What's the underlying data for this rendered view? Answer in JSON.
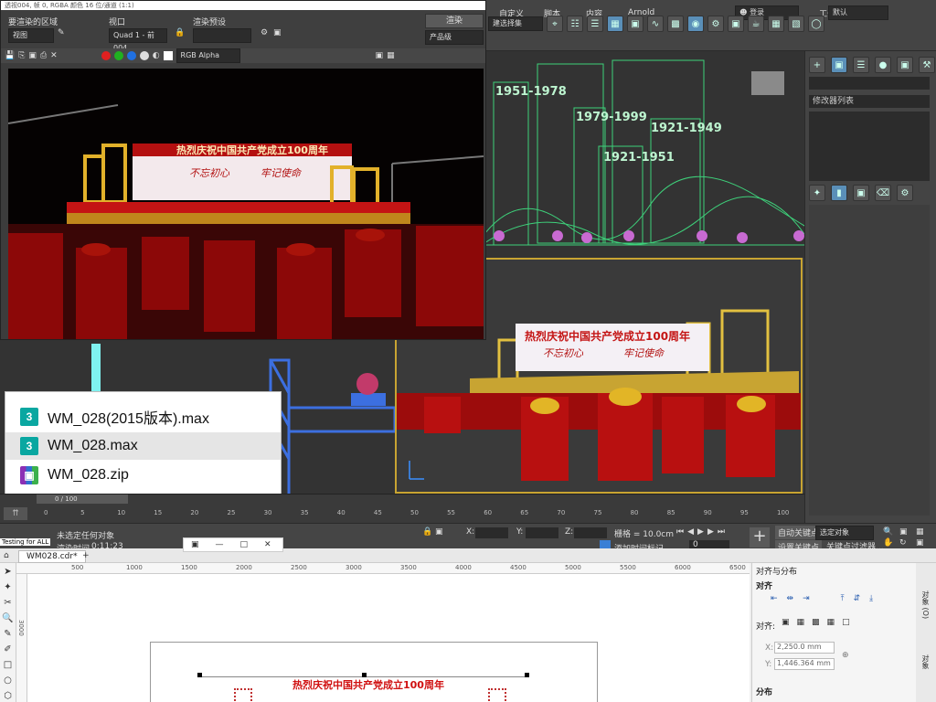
{
  "render_window": {
    "titlebar": "透视004, 帧 0, RGBA 颜色 16 位/通道 (1:1)",
    "area_label": "要渲染的区域",
    "area_value": "视图",
    "viewport_label": "视口",
    "viewport_value": "Quad 1 - 前004",
    "preset_label": "渲染预设",
    "preset_value": "",
    "render_button": "渲染",
    "product_value": "产品级",
    "channel_value": "RGB Alpha"
  },
  "main_toolbar": {
    "selection_set": "建选择集",
    "workspace_label": "工作区:",
    "workspace_value": "默认",
    "menu_items": [
      "自定义",
      "脚本",
      "内容",
      "Arnold"
    ],
    "login": "登录"
  },
  "render_scene": {
    "banner_title": "热烈庆祝中国共产党成立100周年",
    "slogan_left": "不忘初心",
    "slogan_right": "牢记使命"
  },
  "left_viewport": {
    "years": [
      "1951-1978",
      "1979-1999",
      "1921-1949",
      "1921-1951"
    ]
  },
  "files": [
    {
      "name": "WM_028(2015版本).max",
      "type": "max",
      "selected": false
    },
    {
      "name": "WM_028.max",
      "type": "max",
      "selected": true
    },
    {
      "name": "WM_028.zip",
      "type": "zip",
      "selected": false
    }
  ],
  "timeline": {
    "frame_counter": "0 / 100",
    "ticks": [
      "0",
      "5",
      "10",
      "15",
      "20",
      "25",
      "30",
      "35",
      "40",
      "45",
      "50",
      "55",
      "60",
      "65",
      "70",
      "75",
      "80",
      "85",
      "90",
      "95",
      "100"
    ]
  },
  "status": {
    "selection": "未选定任何对象",
    "render_time_label": "渲染时间",
    "render_time": "0:11:23",
    "x_label": "X:",
    "y_label": "Y:",
    "z_label": "Z:",
    "grid": "栅格 = 10.0cm",
    "add_time_tag": "添加时间标记",
    "auto_key": "自动关键点",
    "selected_obj": "选定对象",
    "set_key": "设置关键点",
    "key_filter": "关键点过滤器...",
    "frame_value": "0",
    "testing_label": "Testing for ALL"
  },
  "cmd_panel": {
    "modifier_list": "修改器列表"
  },
  "corel": {
    "doc_tab": "WM028.cdr*",
    "ruler_ticks": [
      "500",
      "1000",
      "1500",
      "2000",
      "2500",
      "3000",
      "3500",
      "4000",
      "4500",
      "5000",
      "5500",
      "6000",
      "6500"
    ],
    "ruler_v": "3000",
    "banner": "热烈庆祝中国共产党成立100周年",
    "dock_title": "对齐与分布",
    "align_label": "对齐",
    "align_to_label": "对齐:",
    "x_label": "X:",
    "x_value": "2,250.0 mm",
    "y_label": "Y:",
    "y_value": "1,446.364 mm",
    "distribute_label": "分布",
    "vtab_1": "对象 (O)",
    "vtab_2": "对象"
  },
  "colors": {
    "accent": "#c8a432",
    "stage_red": "#c41414",
    "wire_green": "#3ed07a"
  }
}
